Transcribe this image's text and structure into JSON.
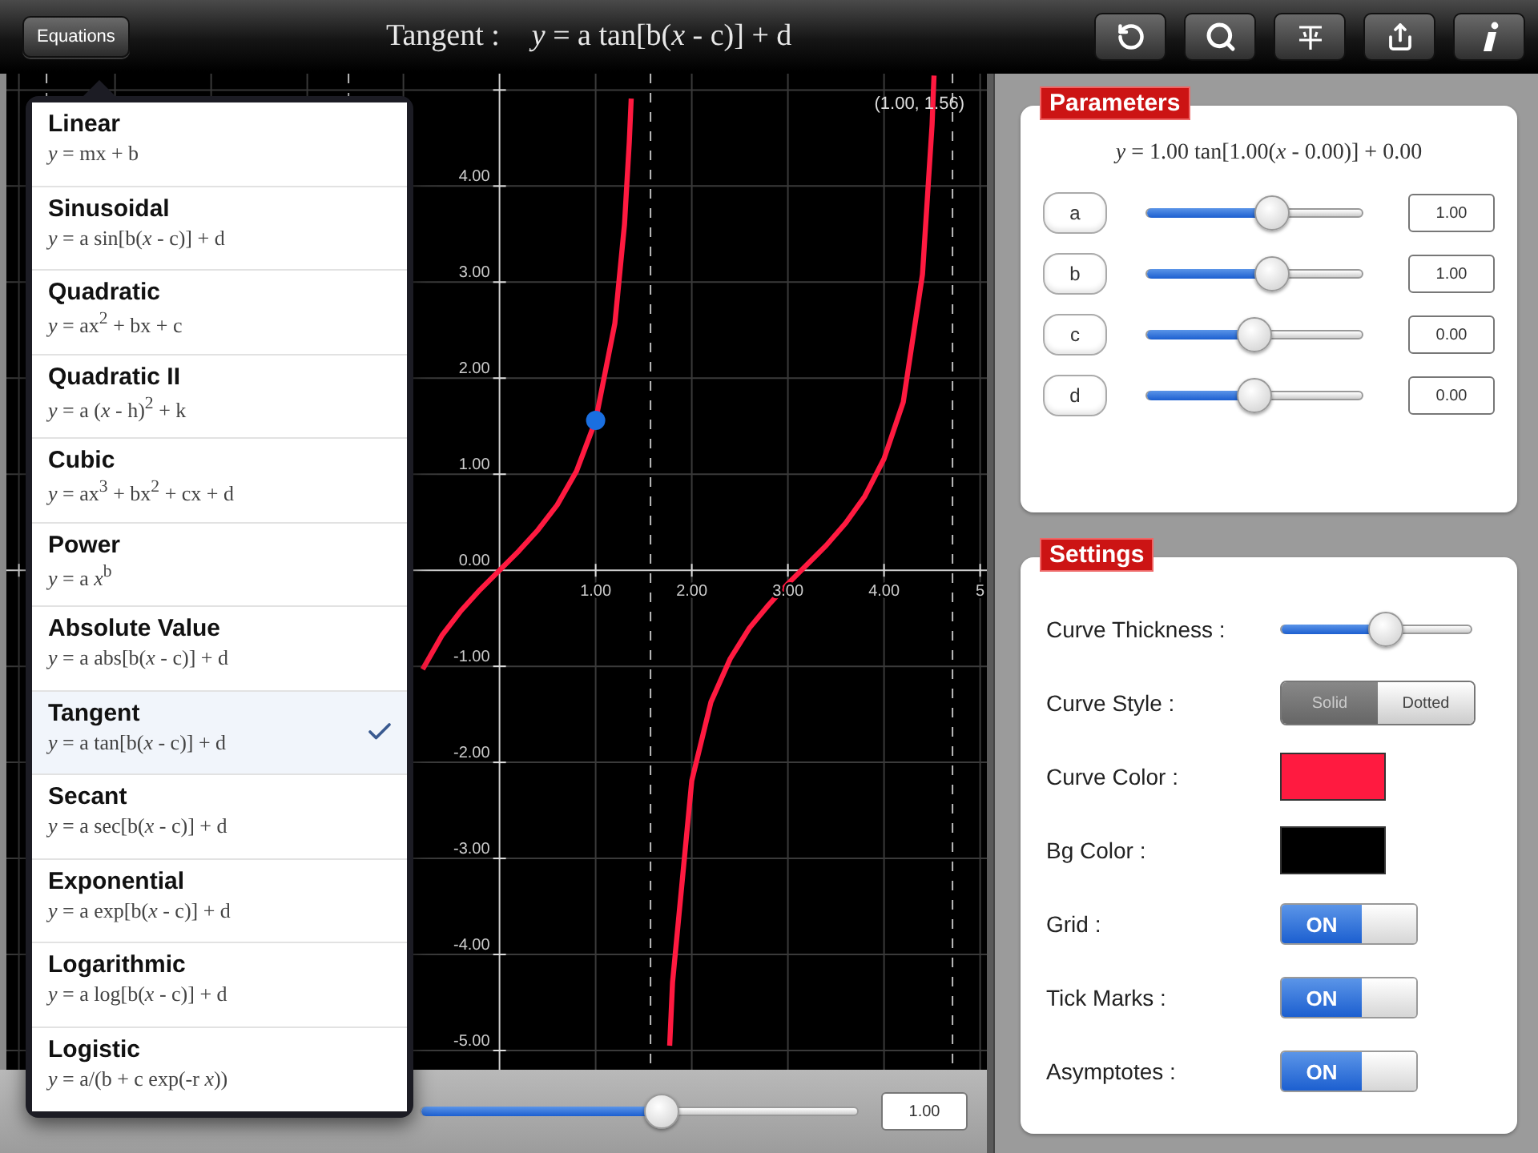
{
  "top_bar": {
    "equations_button": "Equations",
    "title": "Tangent :",
    "formula": "*y* = a tan[b(*x* - c)] + d",
    "tools": [
      {
        "kind": "undo"
      },
      {
        "kind": "search"
      },
      {
        "kind": "axes"
      },
      {
        "kind": "share"
      },
      {
        "kind": "info"
      }
    ]
  },
  "graph": {
    "chart_data": {
      "type": "line",
      "grid": true,
      "xlim": [
        -5.13,
        5.07
      ],
      "ylim": [
        -5.2,
        5.17
      ],
      "x": [
        -0.8,
        -0.6,
        -0.4,
        -0.2,
        0,
        0.2,
        0.4,
        0.6,
        0.8,
        1.0,
        1.2,
        1.3,
        1.35,
        1.37,
        1.57,
        1.77,
        1.8,
        2.0,
        2.2,
        2.4,
        2.6,
        2.8,
        3.0,
        3.2,
        3.4,
        3.6,
        3.8,
        4.0,
        4.2,
        4.4,
        4.5,
        4.52
      ],
      "series": [
        {
          "color": "#ff1a40",
          "values": [
            -1.03,
            -0.68,
            -0.42,
            -0.2,
            0,
            0.2,
            0.42,
            0.68,
            1.03,
            1.56,
            2.57,
            3.6,
            4.46,
            4.91,
            null,
            -4.95,
            -4.29,
            -2.19,
            -1.37,
            -0.92,
            -0.6,
            -0.36,
            -0.14,
            0.06,
            0.26,
            0.49,
            0.77,
            1.16,
            1.75,
            3.08,
            4.64,
            5.15
          ]
        }
      ],
      "xticks": [
        {
          "value": 1,
          "label": "1.00"
        },
        {
          "value": 2,
          "label": "2.00"
        },
        {
          "value": 3,
          "label": "3.00"
        },
        {
          "value": 4,
          "label": "4.00"
        },
        {
          "value": 5,
          "label": "5"
        }
      ],
      "yticks": [
        {
          "value": 4,
          "label": "4.00"
        },
        {
          "value": 3,
          "label": "3.00"
        },
        {
          "value": 2,
          "label": "2.00"
        },
        {
          "value": 1,
          "label": "1.00"
        },
        {
          "value": 0,
          "label": "0.00"
        },
        {
          "value": -1,
          "label": "-1.00"
        },
        {
          "value": -2,
          "label": "-2.00"
        },
        {
          "value": -3,
          "label": "-3.00"
        },
        {
          "value": -4,
          "label": "-4.00"
        },
        {
          "value": -5,
          "label": "-5.00"
        }
      ],
      "annotations": [
        "(1.00, 1.56)"
      ]
    },
    "bottom_slider": {
      "level": 0.55,
      "value": "1.00"
    }
  },
  "equations_menu": {
    "items": [
      {
        "name": "Linear",
        "formula": "*y* = mx + b",
        "selected": false
      },
      {
        "name": "Sinusoidal",
        "formula": "*y* = a sin[b(*x* - c)] + d",
        "selected": false
      },
      {
        "name": "Quadratic",
        "formula": "*y* = ax$^{2}$ + bx + c",
        "selected": false
      },
      {
        "name": "Quadratic II",
        "formula": "*y* = a (*x* - h)$^{2}$ + k",
        "selected": false
      },
      {
        "name": "Cubic",
        "formula": "*y* = ax$^{3}$ + bx$^{2}$ + cx + d",
        "selected": false
      },
      {
        "name": "Power",
        "formula": "*y* = a *x*$^{b}$",
        "selected": false
      },
      {
        "name": "Absolute Value",
        "formula": "*y* = a abs[b(*x* - c)] + d",
        "selected": false
      },
      {
        "name": "Tangent",
        "formula": "*y* = a tan[b(*x* - c)] + d",
        "selected": true
      },
      {
        "name": "Secant",
        "formula": "*y* = a sec[b(*x* - c)] + d",
        "selected": false
      },
      {
        "name": "Exponential",
        "formula": "*y* = a exp[b(*x* - c)] + d",
        "selected": false
      },
      {
        "name": "Logarithmic",
        "formula": "*y* = a log[b(*x* - c)] + d",
        "selected": false
      },
      {
        "name": "Logistic",
        "formula": "*y* = a/(b + c exp(-r *x*))",
        "selected": false
      }
    ]
  },
  "parameters": {
    "title": "Parameters",
    "formula": "*y* = 1.00 tan[1.00(*x* - 0.00)] + 0.00",
    "rows": [
      {
        "name": "a",
        "level": 0.58,
        "value": "1.00"
      },
      {
        "name": "b",
        "level": 0.58,
        "value": "1.00"
      },
      {
        "name": "c",
        "level": 0.5,
        "value": "0.00"
      },
      {
        "name": "d",
        "level": 0.5,
        "value": "0.00"
      }
    ]
  },
  "settings": {
    "title": "Settings",
    "items": [
      {
        "kind": "slider",
        "label": "Curve Thickness :",
        "level": 0.55
      },
      {
        "kind": "segmented",
        "label": "Curve Style :",
        "options": [
          {
            "label": "Solid",
            "selected": true
          },
          {
            "label": "Dotted",
            "selected": false
          }
        ]
      },
      {
        "kind": "color",
        "label": "Curve Color :",
        "color": "#ff1a40"
      },
      {
        "kind": "color",
        "label": "Bg Color :",
        "color": "#000000"
      },
      {
        "kind": "toggle",
        "label": "Grid :",
        "on": true,
        "text": "ON"
      },
      {
        "kind": "toggle",
        "label": "Tick Marks :",
        "on": true,
        "text": "ON"
      },
      {
        "kind": "toggle",
        "label": "Asymptotes :",
        "on": true,
        "text": "ON"
      }
    ]
  }
}
